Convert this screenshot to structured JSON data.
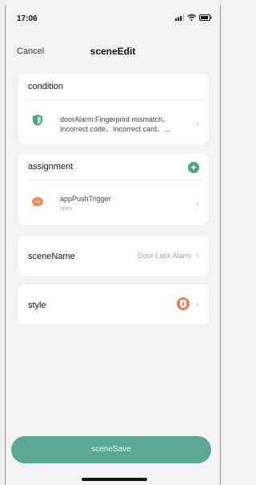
{
  "status_bar": {
    "time": "17:06",
    "icons": "signal wifi battery"
  },
  "nav": {
    "cancel_label": "Cancel",
    "title": "sceneEdit"
  },
  "condition": {
    "section_title": "condition",
    "item_text": "doorAlarm:Fingerprint mismatch、Incorrect code、Incorrect card、..."
  },
  "assignment": {
    "section_title": "assignment",
    "item_title": "appPushTrigger",
    "item_subtitle": "open"
  },
  "scene_name": {
    "label": "sceneName",
    "value": "Door Lock Alarm"
  },
  "style": {
    "label": "style"
  },
  "save_button": {
    "label": "sceneSave"
  },
  "colors": {
    "accent": "#5aa891",
    "style_badge": "#ef7a4f",
    "push_icon": "#ef8a5a",
    "shield_icon": "#4aa58b"
  }
}
